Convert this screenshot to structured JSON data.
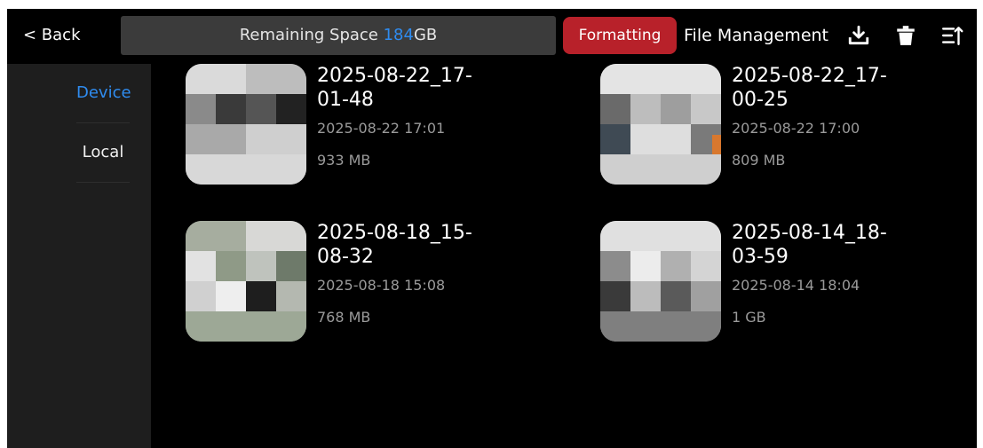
{
  "header": {
    "back_label": "< Back",
    "space_prefix": "Remaining Space ",
    "space_value": "184",
    "space_unit": "GB",
    "format_label": "Formatting",
    "title": "File Management",
    "icons": [
      "download-icon",
      "trash-icon",
      "sort-icon"
    ]
  },
  "sidebar": {
    "items": [
      {
        "label": "Device",
        "active": true
      },
      {
        "label": "Local",
        "active": false
      }
    ]
  },
  "files": [
    {
      "name": "2025-08-22_17-01-48",
      "date": "2025-08-22 17:01",
      "size": "933 MB"
    },
    {
      "name": "2025-08-22_17-00-25",
      "date": "2025-08-22 17:00",
      "size": "809 MB"
    },
    {
      "name": "2025-08-18_15-08-32",
      "date": "2025-08-18 15:08",
      "size": "768 MB"
    },
    {
      "name": "2025-08-14_18-03-59",
      "date": "2025-08-14 18:04",
      "size": "1 GB"
    }
  ],
  "colors": {
    "accent": "#2f8cf0",
    "format_button": "#b8212a",
    "background": "#000000",
    "sidebar": "#1e1e1e"
  }
}
